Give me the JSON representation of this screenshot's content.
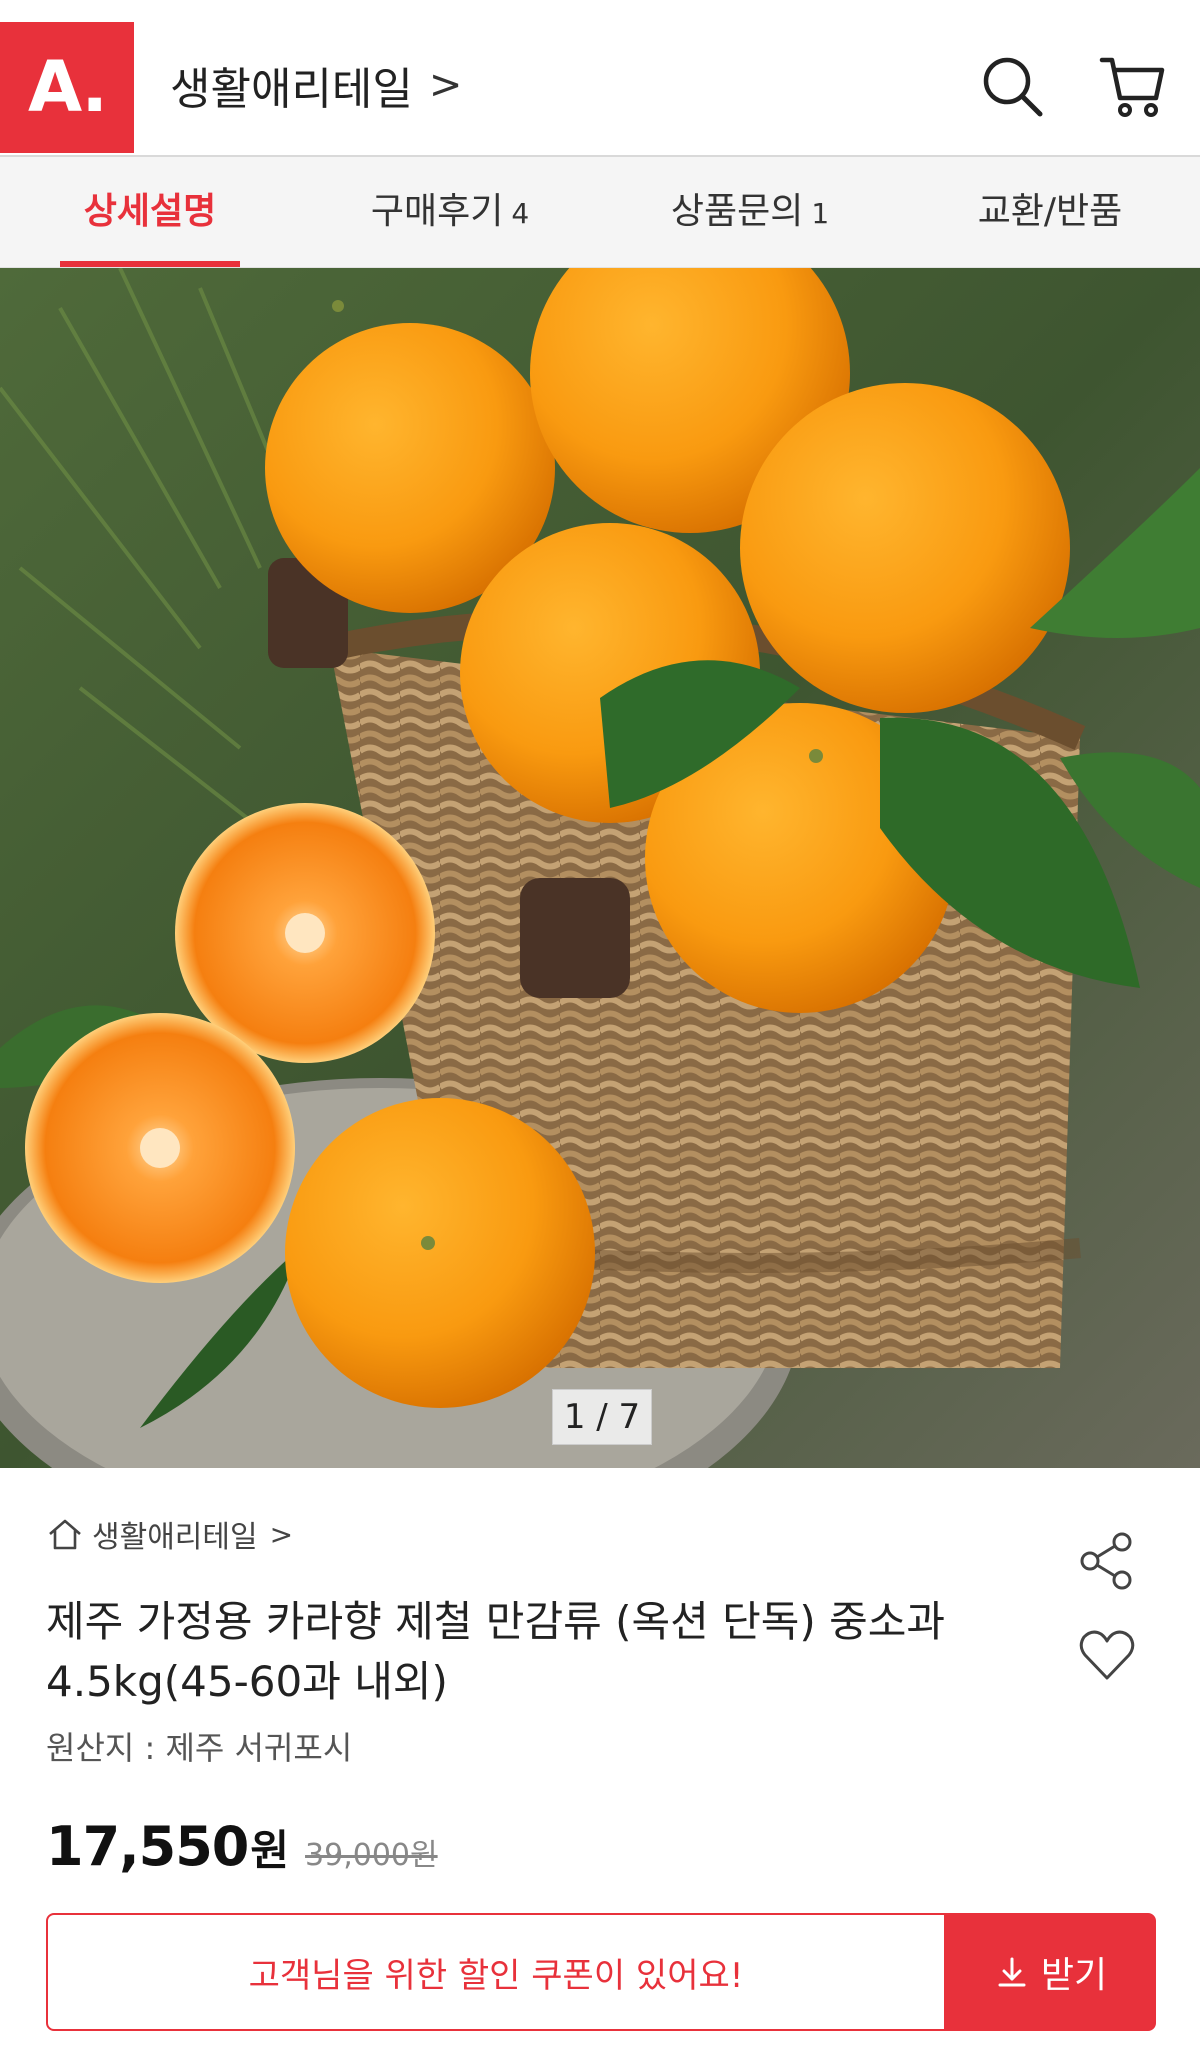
{
  "header": {
    "logo_text": "A.",
    "store_name": "생활애리테일",
    "store_chevron": ">",
    "icons": [
      "search-icon",
      "cart-icon"
    ],
    "brand_color": "#e8313b"
  },
  "tabs": [
    {
      "label": "상세설명",
      "count": "",
      "active": true
    },
    {
      "label": "구매후기",
      "count": "4",
      "active": false
    },
    {
      "label": "상품문의",
      "count": "1",
      "active": false
    },
    {
      "label": "교환/반품",
      "count": "",
      "active": false
    }
  ],
  "gallery": {
    "pager": "1 / 7"
  },
  "product": {
    "breadcrumb": "생활애리테일",
    "breadcrumb_chevron": ">",
    "title": "제주 가정용 카라향 제철 만감류 (옥션 단독) 중소과 4.5kg(45-60과 내외)",
    "origin": "원산지 : 제주 서귀포시",
    "price": "17,550",
    "price_unit": "원",
    "original_price": "39,000원"
  },
  "coupon": {
    "message": "고객님을 위한 할인 쿠폰이 있어요!",
    "button_label": "받기"
  }
}
